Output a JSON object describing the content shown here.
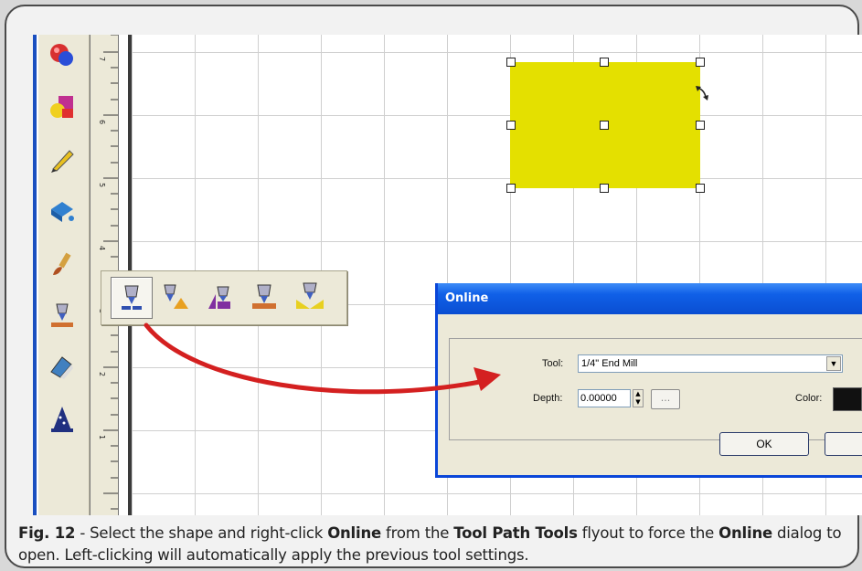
{
  "toolbar": {
    "tools": [
      {
        "name": "shapes-tool-icon",
        "color": "#d83030"
      },
      {
        "name": "object-tool-icon",
        "color": "#c03090"
      },
      {
        "name": "pencil-tool-icon",
        "color": "#e8c020"
      },
      {
        "name": "fill-tool-icon",
        "color": "#3080d0"
      },
      {
        "name": "brush-tool-icon",
        "color": "#b05020"
      },
      {
        "name": "toolpath-tool-icon",
        "color": "#4060c0"
      },
      {
        "name": "eraser-tool-icon",
        "color": "#4080c0"
      },
      {
        "name": "wizard-tool-icon",
        "color": "#203080"
      }
    ]
  },
  "ruler": {
    "labels": [
      "7",
      "6",
      "5",
      "4",
      "3",
      "2",
      "1"
    ]
  },
  "flyout": {
    "buttons": [
      "online-toolpath-icon",
      "offset-toolpath-icon",
      "pocket-toolpath-icon",
      "drill-toolpath-icon",
      "vcarve-toolpath-icon"
    ]
  },
  "dialog": {
    "title": "Online",
    "tool_label": "Tool:",
    "tool_value": "1/4\" End Mill",
    "depth_label": "Depth:",
    "depth_value": "0.00000",
    "browse_label": "...",
    "color_label": "Color:",
    "ok_label": "OK",
    "accent": "#0a46d8"
  },
  "shape": {
    "color": "#e4e000"
  },
  "caption": {
    "fig": "Fig. 12",
    "t1": " - Select the shape and right-click ",
    "b1": "Online",
    "t2": " from the ",
    "b2": "Tool Path Tools",
    "t3": " flyout to force the ",
    "b3": "Online",
    "t4": " dialog to open. Left-clicking will automatically apply the previous tool settings."
  }
}
